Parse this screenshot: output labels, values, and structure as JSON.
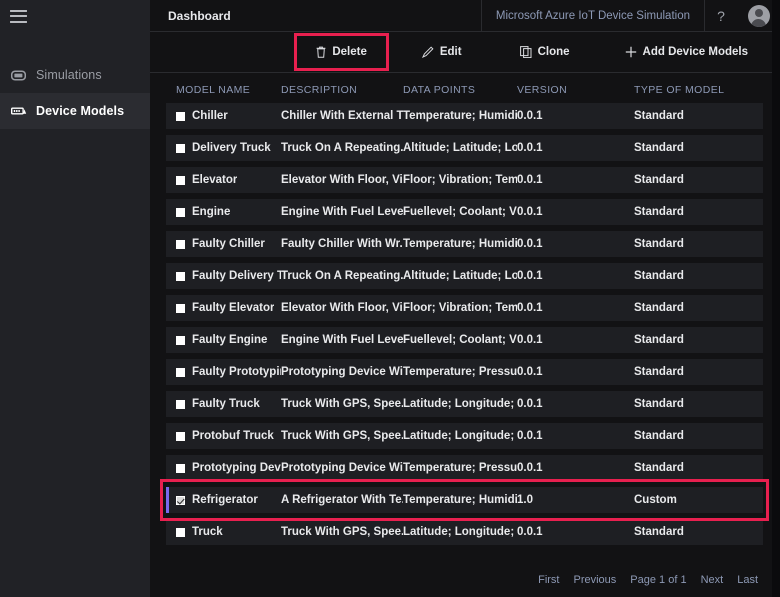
{
  "sidebar": {
    "menu_icon": "hamburger-icon",
    "items": [
      {
        "label": "Simulations",
        "icon": "simulations-icon",
        "active": false
      },
      {
        "label": "Device Models",
        "icon": "device-models-icon",
        "active": true
      }
    ]
  },
  "header": {
    "title": "Dashboard",
    "app_name": "Microsoft Azure IoT Device Simulation",
    "help_glyph": "?",
    "avatar": "user-avatar-icon"
  },
  "toolbar": {
    "delete_label": "Delete",
    "edit_label": "Edit",
    "clone_label": "Clone",
    "add_label": "Add Device Models"
  },
  "table": {
    "columns": [
      "MODEL NAME",
      "DESCRIPTION",
      "DATA POINTS",
      "VERSION",
      "TYPE OF MODEL"
    ],
    "rows": [
      {
        "name": "Chiller",
        "description": "Chiller With External T...",
        "data_points": "Temperature; Humidit...",
        "version": "0.0.1",
        "type": "Standard",
        "selected": false
      },
      {
        "name": "Delivery Truck",
        "description": "Truck On A Repeating...",
        "data_points": "Altitude; Latitude; Lon...",
        "version": "0.0.1",
        "type": "Standard",
        "selected": false
      },
      {
        "name": "Elevator",
        "description": "Elevator With Floor, Vi...",
        "data_points": "Floor; Vibration; Temp...",
        "version": "0.0.1",
        "type": "Standard",
        "selected": false
      },
      {
        "name": "Engine",
        "description": "Engine With Fuel Leve...",
        "data_points": "Fuellevel; Coolant; Vib...",
        "version": "0.0.1",
        "type": "Standard",
        "selected": false
      },
      {
        "name": "Faulty Chiller",
        "description": "Faulty Chiller With Wr...",
        "data_points": "Temperature; Humidit...",
        "version": "0.0.1",
        "type": "Standard",
        "selected": false
      },
      {
        "name": "Faulty Delivery Tr...",
        "description": "Truck On A Repeating...",
        "data_points": "Altitude; Latitude; Lon...",
        "version": "0.0.1",
        "type": "Standard",
        "selected": false
      },
      {
        "name": "Faulty Elevator",
        "description": "Elevator With Floor, Vi...",
        "data_points": "Floor; Vibration; Temp...",
        "version": "0.0.1",
        "type": "Standard",
        "selected": false
      },
      {
        "name": "Faulty Engine",
        "description": "Engine With Fuel Leve...",
        "data_points": "Fuellevel; Coolant; Vib...",
        "version": "0.0.1",
        "type": "Standard",
        "selected": false
      },
      {
        "name": "Faulty Prototypin...",
        "description": "Prototyping Device Wi...",
        "data_points": "Temperature; Pressure...",
        "version": "0.0.1",
        "type": "Standard",
        "selected": false
      },
      {
        "name": "Faulty Truck",
        "description": "Truck With GPS, Spee...",
        "data_points": "Latitude; Longitude; S...",
        "version": "0.0.1",
        "type": "Standard",
        "selected": false
      },
      {
        "name": "Protobuf Truck",
        "description": "Truck With GPS, Spee...",
        "data_points": "Latitude; Longitude; S...",
        "version": "0.0.1",
        "type": "Standard",
        "selected": false
      },
      {
        "name": "Prototyping Device",
        "description": "Prototyping Device Wi...",
        "data_points": "Temperature; Pressure...",
        "version": "0.0.1",
        "type": "Standard",
        "selected": false
      },
      {
        "name": "Refrigerator",
        "description": "A Refrigerator With Te...",
        "data_points": "Temperature; Humidity",
        "version": "1.0",
        "type": "Custom",
        "selected": true
      },
      {
        "name": "Truck",
        "description": "Truck With GPS, Spee...",
        "data_points": "Latitude; Longitude; S...",
        "version": "0.0.1",
        "type": "Standard",
        "selected": false
      }
    ]
  },
  "pagination": {
    "first": "First",
    "previous": "Previous",
    "status": "Page 1 of 1",
    "next": "Next",
    "last": "Last"
  },
  "annotations": {
    "highlight_color": "#e8204f"
  }
}
